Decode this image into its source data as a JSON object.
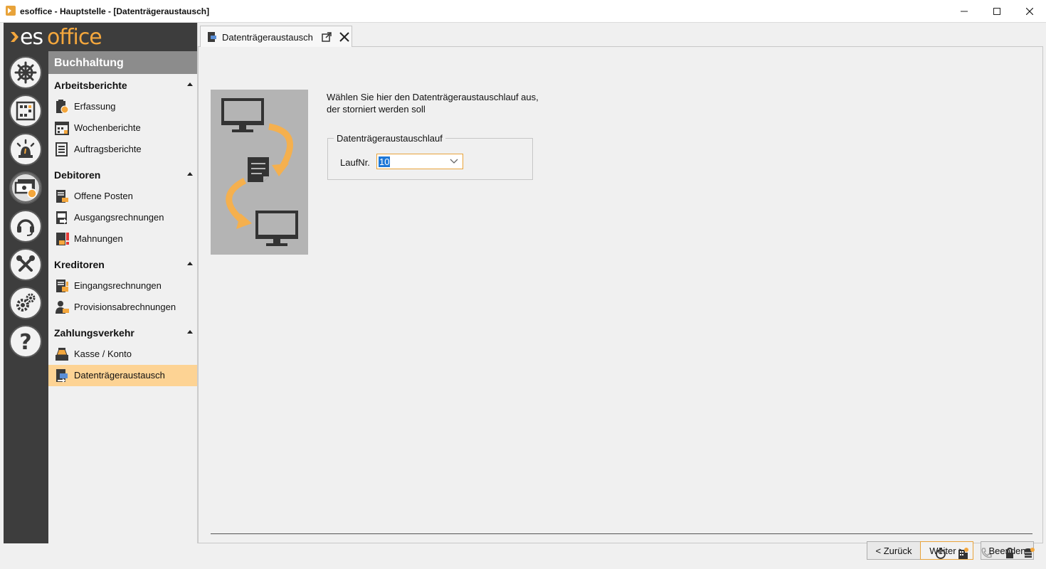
{
  "window": {
    "title": "esoffice - Hauptstelle - [Datenträgeraustausch]"
  },
  "brand": {
    "part1": "es",
    "part2": "office",
    "accent_color": "#f4a73d"
  },
  "rail": {
    "items": [
      {
        "icon": "ships-wheel-icon"
      },
      {
        "icon": "planner-grid-icon"
      },
      {
        "icon": "alarm-light-icon"
      },
      {
        "icon": "money-icon",
        "active": true
      },
      {
        "icon": "headset-icon"
      },
      {
        "icon": "tools-icon"
      },
      {
        "icon": "gears-icon"
      },
      {
        "icon": "help-icon"
      }
    ]
  },
  "nav": {
    "header": "Buchhaltung",
    "groups": [
      {
        "label": "Arbeitsberichte",
        "items": [
          {
            "label": "Erfassung"
          },
          {
            "label": "Wochenberichte"
          },
          {
            "label": "Auftragsberichte"
          }
        ]
      },
      {
        "label": "Debitoren",
        "items": [
          {
            "label": "Offene Posten"
          },
          {
            "label": "Ausgangsrechnungen"
          },
          {
            "label": "Mahnungen"
          }
        ]
      },
      {
        "label": "Kreditoren",
        "items": [
          {
            "label": "Eingangsrechnungen"
          },
          {
            "label": "Provisionsabrechnungen"
          }
        ]
      },
      {
        "label": "Zahlungsverkehr",
        "items": [
          {
            "label": "Kasse / Konto"
          },
          {
            "label": "Datenträgeraustausch",
            "selected": true
          }
        ]
      }
    ],
    "selected_color": "#fdd394"
  },
  "tab": {
    "label": "Datenträgeraustausch"
  },
  "wizard": {
    "instruction_line1": "Wählen Sie hier den Datenträgeraustauschlauf aus,",
    "instruction_line2": "der storniert werden soll",
    "group_title": "Datenträgeraustauschlauf",
    "field_label": "LaufNr.",
    "field_value": "10",
    "back_label": "< Zurück",
    "next_label": "Weiter >",
    "finish_label": "Beenden"
  },
  "statusbar": {
    "icons": [
      "stopwatch-icon",
      "building-icon",
      "phone-icon",
      "lock-icon",
      "database-icon"
    ]
  }
}
